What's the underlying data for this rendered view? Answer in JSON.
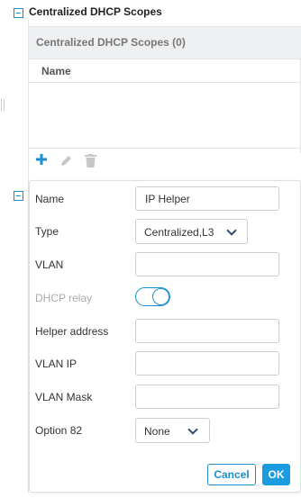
{
  "section": {
    "title": "Centralized DHCP Scopes",
    "panel_title": "Centralized DHCP Scopes (0)",
    "column_name": "Name"
  },
  "toolbar": {
    "add_icon": "plus-icon",
    "edit_icon": "pencil-icon",
    "delete_icon": "trash-icon"
  },
  "form": {
    "name_label": "Name",
    "name_value": "IP Helper",
    "type_label": "Type",
    "type_value": "Centralized,L3",
    "vlan_label": "VLAN",
    "vlan_value": "",
    "dhcp_relay_label": "DHCP relay",
    "dhcp_relay_on": true,
    "helper_address_label": "Helper address",
    "helper_address_value": "",
    "vlan_ip_label": "VLAN IP",
    "vlan_ip_value": "",
    "vlan_mask_label": "VLAN Mask",
    "vlan_mask_value": "",
    "option82_label": "Option 82",
    "option82_value": "None",
    "cancel_label": "Cancel",
    "ok_label": "OK"
  },
  "colors": {
    "accent": "#1c8fcf",
    "ok_button": "#1c9ce0",
    "panel_header_bg": "#eef0f2"
  }
}
